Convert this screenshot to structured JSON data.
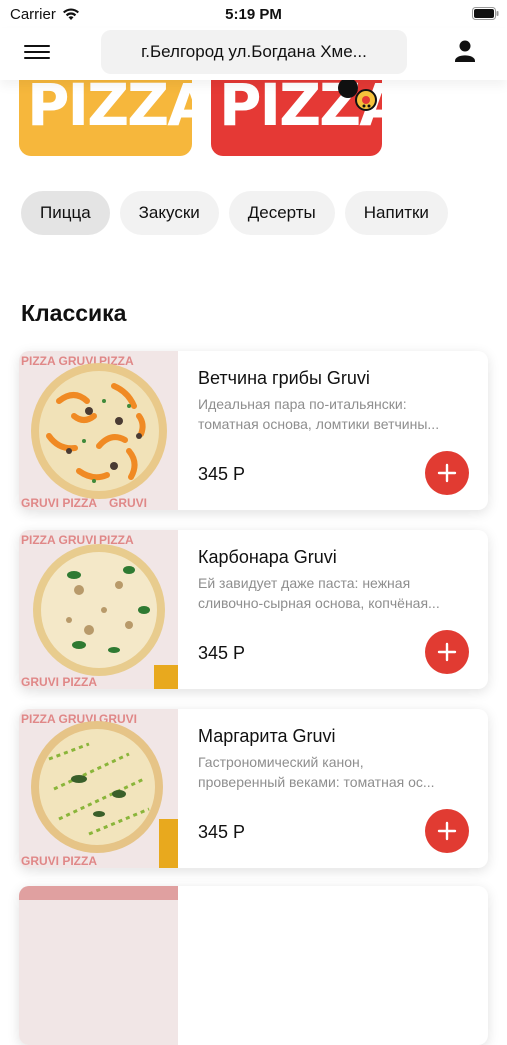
{
  "status_bar": {
    "carrier": "Carrier",
    "time": "5:19 PM"
  },
  "header": {
    "address": "г.Белгород ул.Богдана Хме..."
  },
  "banners": [
    {
      "text": "PIZZA"
    },
    {
      "text": "PIZZA"
    }
  ],
  "categories": [
    {
      "label": "Пицца",
      "active": true
    },
    {
      "label": "Закуски",
      "active": false
    },
    {
      "label": "Десерты",
      "active": false
    },
    {
      "label": "Напитки",
      "active": false
    }
  ],
  "section": {
    "title": "Классика"
  },
  "products": [
    {
      "name": "Ветчина грибы Gruvi",
      "desc_line1": "Идеальная пара по-итальянски:",
      "desc_line2": "томатная основа, ломтики ветчины...",
      "price": "345 Р"
    },
    {
      "name": "Карбонара Gruvi",
      "desc_line1": "Ей завидует даже паста: нежная",
      "desc_line2": "сливочно-сырная основа, копчёная...",
      "price": "345 Р"
    },
    {
      "name": "Маргарита Gruvi",
      "desc_line1": "Гастрономический канон,",
      "desc_line2": "проверенный веками: томатная ос...",
      "price": "345 Р"
    }
  ],
  "colors": {
    "accent": "#e13b32",
    "chip_bg": "#f2f2f2"
  }
}
